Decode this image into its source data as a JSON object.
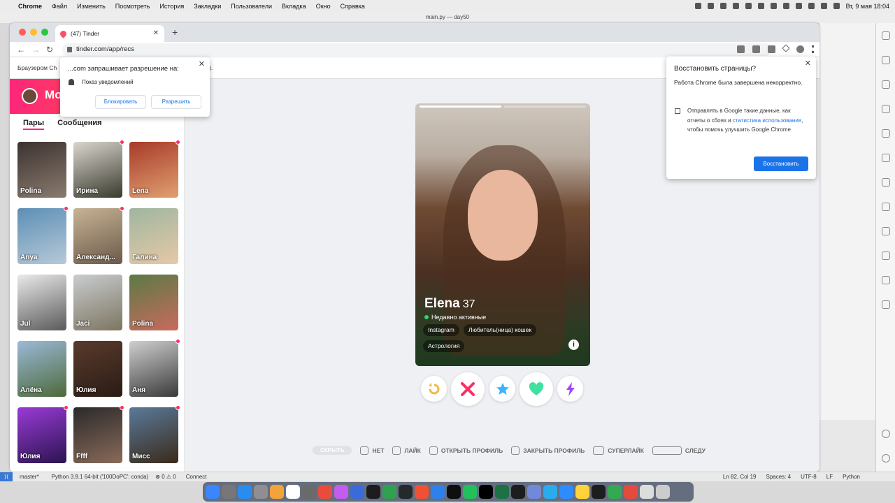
{
  "menubar": {
    "apple": "",
    "app": "Chrome",
    "items": [
      "Файл",
      "Изменить",
      "Посмотреть",
      "История",
      "Закладки",
      "Пользователи",
      "Вкладка",
      "Окно",
      "Справка"
    ],
    "clock": "Вт, 9 мая 18:04"
  },
  "ide": {
    "title": "main.py — day50"
  },
  "browser": {
    "tab_title": "(47) Tinder",
    "url": "tinder.com/app/recs",
    "infobar_text": "Браузером Ch"
  },
  "permission": {
    "title": "...com запрашивает разрешение на:",
    "subtitle": "Показ уведомлений",
    "block": "Блокировать",
    "allow": "Разрешить"
  },
  "restore": {
    "title": "Восстановить страницы?",
    "desc": "Работа Chrome была завершена некорректно.",
    "consent_1": "Отправлять в Google такие данные, как отчеты о сбоях и",
    "consent_link": "статистика использования",
    "consent_2": ", чтобы помочь улучшить Google Chrome",
    "button": "Восстановить"
  },
  "sidebar": {
    "title": "Мо",
    "tabs": [
      "Пары",
      "Сообщения"
    ],
    "matches": [
      {
        "name": "Polina",
        "dot": false,
        "c1": "#3b3230",
        "c2": "#8a7b6e"
      },
      {
        "name": "Ирина",
        "dot": true,
        "c1": "#d9d6cf",
        "c2": "#3a3a2c"
      },
      {
        "name": "Lena",
        "dot": true,
        "c1": "#a83a2a",
        "c2": "#e0a070"
      },
      {
        "name": "Anya",
        "dot": true,
        "c1": "#5c8fb5",
        "c2": "#b7c9d8"
      },
      {
        "name": "Александ...",
        "dot": true,
        "c1": "#c7b394",
        "c2": "#6b5a4a"
      },
      {
        "name": "Галина",
        "dot": false,
        "c1": "#9fb6a0",
        "c2": "#e6c8a6"
      },
      {
        "name": "Jul",
        "dot": false,
        "c1": "#eaeaea",
        "c2": "#5a5a5a"
      },
      {
        "name": "Jaci",
        "dot": false,
        "c1": "#c9ccd0",
        "c2": "#7c7560"
      },
      {
        "name": "Polina",
        "dot": false,
        "c1": "#5b7a45",
        "c2": "#c96a5e"
      },
      {
        "name": "Алёна",
        "dot": false,
        "c1": "#9cb9d9",
        "c2": "#4c6a3a"
      },
      {
        "name": "Юлия",
        "dot": false,
        "c1": "#5a3a2c",
        "c2": "#2a1c16"
      },
      {
        "name": "Аня",
        "dot": true,
        "c1": "#cfcfcf",
        "c2": "#3a3a3a"
      },
      {
        "name": "Юлия",
        "dot": true,
        "c1": "#9a3bd6",
        "c2": "#2a1450"
      },
      {
        "name": "Ffff",
        "dot": true,
        "c1": "#2a2a2a",
        "c2": "#8a6a5a"
      },
      {
        "name": "Мисс",
        "dot": true,
        "c1": "#5a7a9a",
        "c2": "#3a2a1a"
      }
    ]
  },
  "profile": {
    "name": "Elena",
    "age": "37",
    "status": "Недавно активные",
    "chips": [
      "Instagram",
      "Любитель(ница) кошек",
      "Астрология"
    ],
    "info": "i"
  },
  "actions": {
    "rewind_color": "#f5b748",
    "nope_color": "#fd2d63",
    "super_color": "#1786ff",
    "like_color": "#21d08e",
    "boost_color": "#a044ff"
  },
  "hints": {
    "hide": "СКРЫТЬ",
    "no": "НЕТ",
    "like": "ЛАЙК",
    "open": "ОТКРЫТЬ ПРОФИЛЬ",
    "close": "ЗАКРЫТЬ ПРОФИЛЬ",
    "superlike": "СУПЕРЛАЙК",
    "next": "СЛЕДУ"
  },
  "statusbar": {
    "branch": "master*",
    "python": "Python 3.9.1 64-bit ('100DoPC': conda)",
    "problems": "⊗ 0 ⚠ 0",
    "connect": "Connect",
    "position": "Ln 82, Col 19",
    "spaces": "Spaces: 4",
    "encoding": "UTF-8",
    "eol": "LF",
    "lang": "Python"
  }
}
